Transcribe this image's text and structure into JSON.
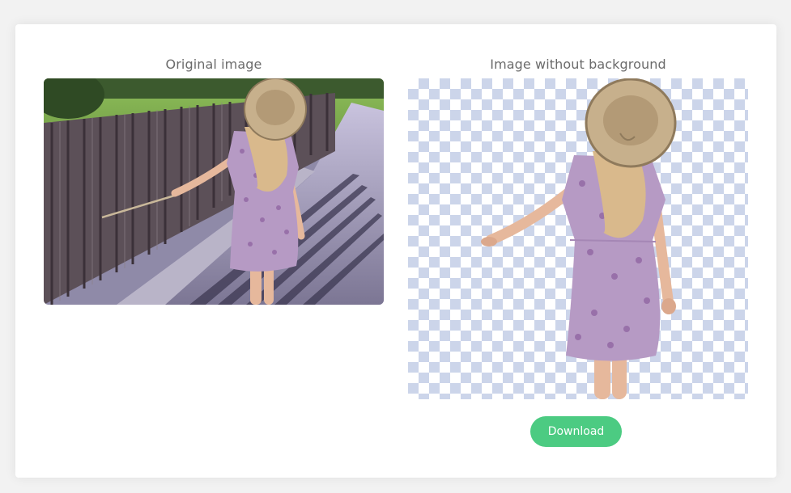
{
  "panels": {
    "original_title": "Original image",
    "result_title": "Image without background"
  },
  "actions": {
    "download_label": "Download"
  },
  "colors": {
    "download_button": "#4ccb82",
    "checker": "#ccd5ea",
    "title_text": "#6b6b6b"
  }
}
